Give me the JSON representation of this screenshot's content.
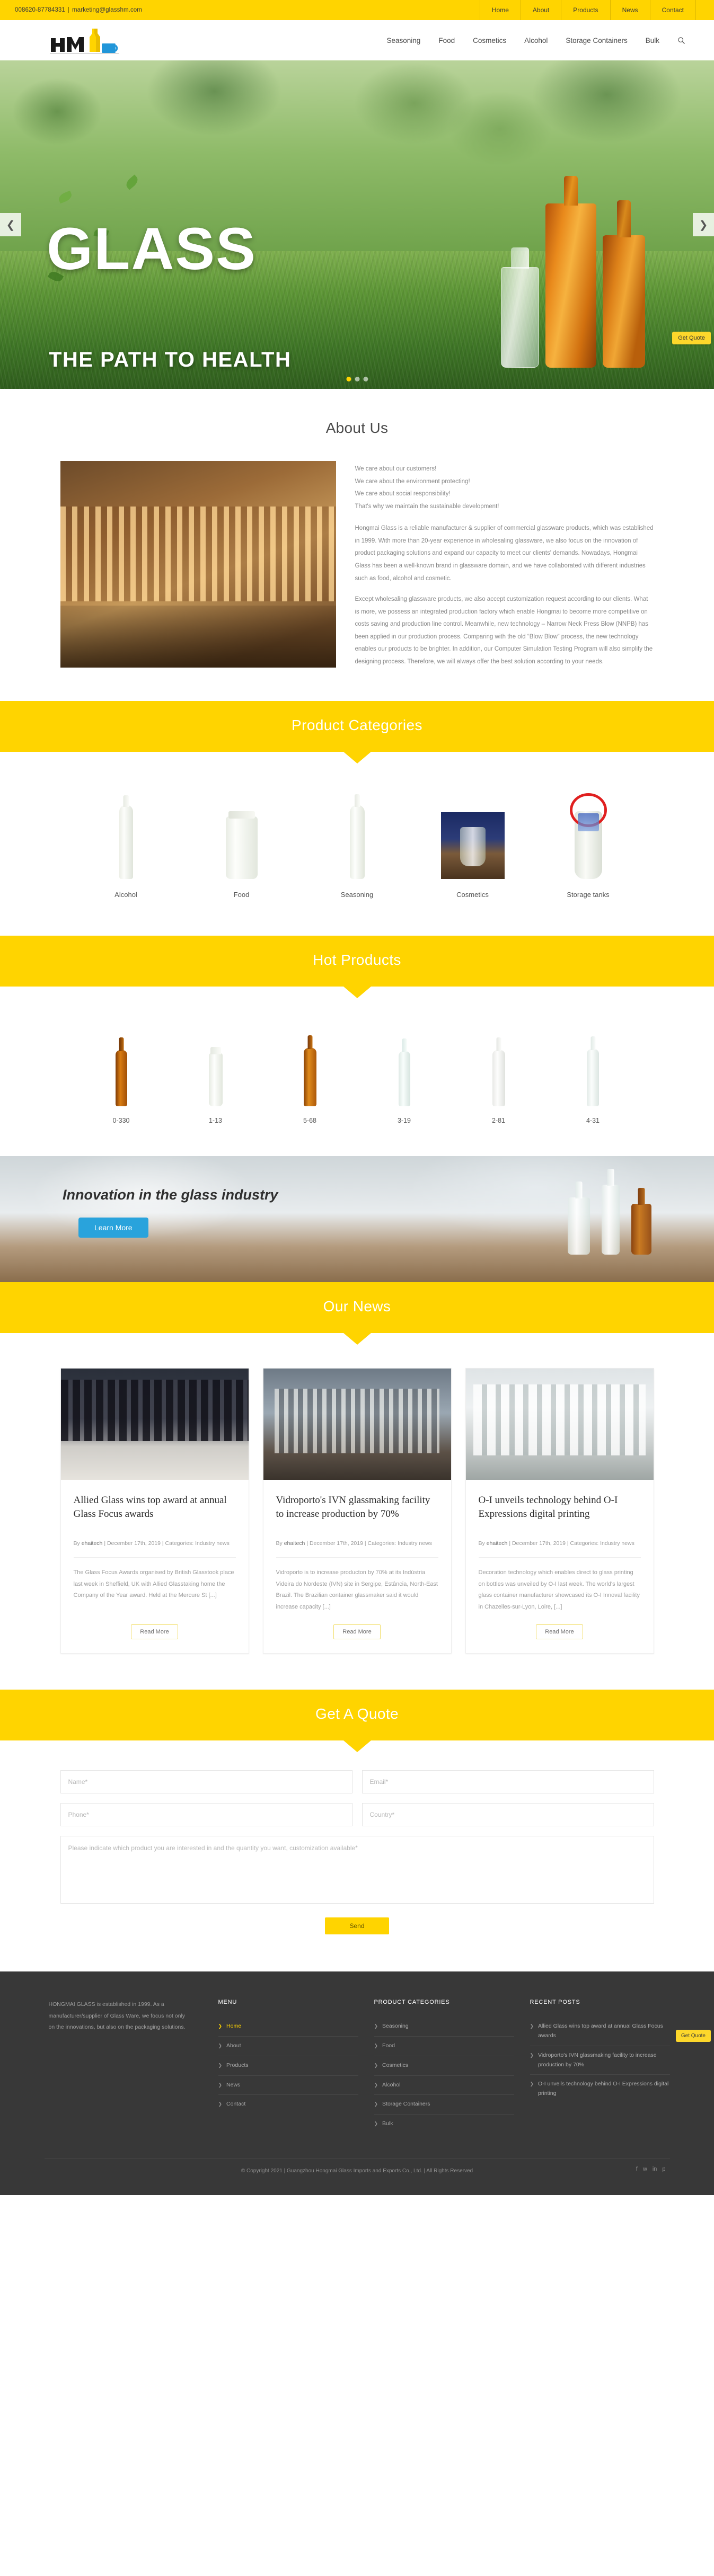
{
  "topbar": {
    "phone": "008620-87784331",
    "separator": "|",
    "email": "marketing@glasshm.com",
    "nav": [
      {
        "label": "Home"
      },
      {
        "label": "About"
      },
      {
        "label": "Products"
      },
      {
        "label": "News"
      },
      {
        "label": "Contact"
      }
    ]
  },
  "header": {
    "logo_alt": "HM Hongmai Glass",
    "nav": [
      {
        "label": "Seasoning"
      },
      {
        "label": "Food"
      },
      {
        "label": "Cosmetics"
      },
      {
        "label": "Alcohol"
      },
      {
        "label": "Storage Containers"
      },
      {
        "label": "Bulk"
      }
    ],
    "search_icon": "search-icon"
  },
  "hero": {
    "title": "GLASS",
    "subtitle": "THE PATH TO HEALTH",
    "prev_icon": "chevron-left-icon",
    "next_icon": "chevron-right-icon",
    "quote_tab": "Get Quote"
  },
  "about": {
    "heading": "About Us",
    "lead": [
      "We care about our customers!",
      "We care about the environment protecting!",
      "We care about social responsibility!",
      "That's why we maintain the sustainable development!"
    ],
    "paragraphs": [
      "Hongmai Glass is a reliable manufacturer & supplier of commercial glassware products, which was established in 1999. With more than 20-year experience in wholesaling glassware, we also focus on the innovation of product packaging solutions and expand our capacity to meet our clients' demands. Nowadays, Hongmai Glass has been a well-known brand in glassware domain, and we have collaborated with different industries such as food, alcohol and cosmetic.",
      "Except wholesaling glassware products, we also accept customization request according to our clients. What is more, we possess an integrated production factory which enable Hongmai to become more competitive on costs saving and production line control. Meanwhile, new technology – Narrow Neck Press Blow (NNPB) has been applied in our production process. Comparing with the old “Blow Blow” process, the new technology enables our products to be brighter. In addition, our Computer Simulation Testing Program will also simplify the designing process. Therefore, we will always offer the best solution according to your needs."
    ]
  },
  "categories": {
    "heading": "Product Categories",
    "items": [
      {
        "label": "Alcohol"
      },
      {
        "label": "Food"
      },
      {
        "label": "Seasoning"
      },
      {
        "label": "Cosmetics"
      },
      {
        "label": "Storage tanks"
      }
    ]
  },
  "hot_products": {
    "heading": "Hot Products",
    "items": [
      {
        "label": "0-330"
      },
      {
        "label": "1-13"
      },
      {
        "label": "5-68"
      },
      {
        "label": "3-19"
      },
      {
        "label": "2-81"
      },
      {
        "label": "4-31"
      }
    ]
  },
  "promo": {
    "title": "Innovation in the glass industry",
    "button": "Learn More"
  },
  "news": {
    "heading": "Our News",
    "cards": [
      {
        "title": "Allied Glass wins top award at annual Glass Focus awards",
        "meta_by": "By",
        "author": "ehaitech",
        "meta_rest": "| December 17th, 2019 | Categories: Industry news",
        "excerpt": "The Glass Focus Awards organised by British Glasstook place last week in Sheffield, UK with Allied Glasstaking home the Company of the Year award. Held at the Mercure St [...]",
        "button": "Read More"
      },
      {
        "title": "Vidroporto's IVN glassmaking facility to increase production by 70%",
        "meta_by": "By",
        "author": "ehaitech",
        "meta_rest": "| December 17th, 2019 | Categories: Industry news",
        "excerpt": "Vidroporto is to increase producton by 70% at its Indústria Videira do Nordeste (IVN) site in Sergipe, Estância, North-East Brazil. The Brazilian container glassmaker said it would increase capacity [...]",
        "button": "Read More"
      },
      {
        "title": "O-I unveils technology behind O-I Expressions digital printing",
        "meta_by": "By",
        "author": "ehaitech",
        "meta_rest": "| December 17th, 2019 | Categories: Industry news",
        "excerpt": "Decoration technology which enables direct to glass printing on bottles was unveiled by O-I last week. The world's largest glass container manufacturer showcased its O-I Innoval facility in Chazelles-sur-Lyon, Loire, [...]",
        "button": "Read More"
      }
    ]
  },
  "quote_form": {
    "heading": "Get A Quote",
    "name_placeholder": "Name*",
    "email_placeholder": "Email*",
    "phone_placeholder": "Phone*",
    "country_placeholder": "Country*",
    "message_placeholder": "Please indicate which product you are interested in and the quantity you want, customization available*",
    "name_value": "",
    "email_value": "",
    "phone_value": "",
    "country_value": "",
    "message_value": "",
    "send_label": "Send"
  },
  "footer": {
    "intro": "HONGMAI GLASS is established in 1999. As a manufacturer/supplier of Glass Ware, we focus not only on the innovations, but also on the packaging solutions.",
    "menu_heading": "MENU",
    "menu": [
      {
        "label": "Home",
        "active": true
      },
      {
        "label": "About",
        "active": false
      },
      {
        "label": "Products",
        "active": false
      },
      {
        "label": "News",
        "active": false
      },
      {
        "label": "Contact",
        "active": false
      }
    ],
    "categories_heading": "PRODUCT CATEGORIES",
    "categories": [
      {
        "label": "Seasoning"
      },
      {
        "label": "Food"
      },
      {
        "label": "Cosmetics"
      },
      {
        "label": "Alcohol"
      },
      {
        "label": "Storage Containers"
      },
      {
        "label": "Bulk"
      }
    ],
    "recent_heading": "RECENT POSTS",
    "recent": [
      {
        "label": "Allied Glass wins top award at annual Glass Focus awards"
      },
      {
        "label": "Vidroporto's IVN glassmaking facility to increase production by 70%"
      },
      {
        "label": "O-I unveils technology behind O-I Expressions digital printing"
      }
    ],
    "copyright": "© Copyright 2021 | Guangzhou Hongmai Glass Imports and Exports Co., Ltd. | All Rights Reserved",
    "quote_tab": "Get Quote",
    "social": [
      "facebook-icon",
      "twitter-icon",
      "linkedin-icon",
      "pinterest-icon"
    ]
  },
  "colors": {
    "brand_yellow": "#ffd400",
    "accent_blue": "#29a3dc",
    "footer_bg": "#383838"
  }
}
